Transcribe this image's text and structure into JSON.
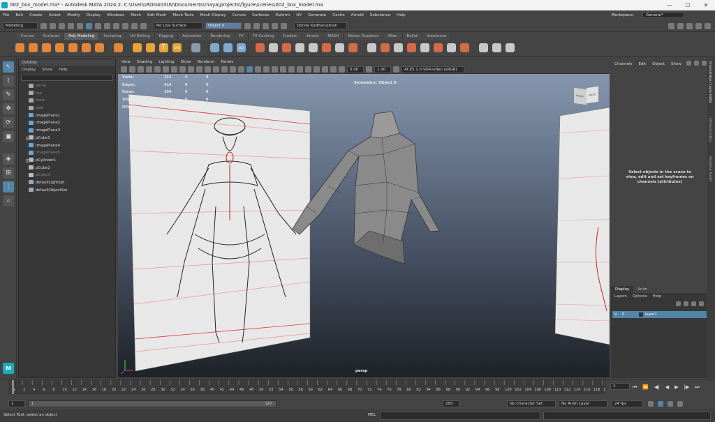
{
  "window": {
    "title": "002_box_model.ma* - Autodesk MAYA 2024.2: C:\\Users\\ROG403UV\\Documents\\maya\\projects\\figure\\scenes\\002_box_model.ma",
    "controls": [
      "—",
      "☐",
      "✕"
    ]
  },
  "menubar": {
    "items": [
      "File",
      "Edit",
      "Create",
      "Select",
      "Modify",
      "Display",
      "Windows",
      "Mesh",
      "Edit Mesh",
      "Mesh Tools",
      "Mesh Display",
      "Curves",
      "Surfaces",
      "Deform",
      "UV",
      "Generate",
      "Cache",
      "Arnold",
      "Substance",
      "Help"
    ],
    "workspace_label": "Workspace:",
    "workspace_value": "General*"
  },
  "statusline": {
    "mode": "Modeling",
    "live_surface": "No Live Surface",
    "symmetry": "Object X",
    "user": "Donita Kadharusman"
  },
  "shelf": {
    "tabs": [
      "Curves",
      "Surfaces",
      "Poly Modeling",
      "Sculpting",
      "UV Editing",
      "Rigging",
      "Animation",
      "Rendering",
      "FX",
      "FX Caching",
      "Custom",
      "Arnold",
      "MASH",
      "Motion Graphics",
      "XGen",
      "Bullet",
      "Substance"
    ],
    "active_tab": "Poly Modeling",
    "texts": {
      "svg": "SVG",
      "grid": "0.0"
    }
  },
  "outliner": {
    "title": "Outliner",
    "menu": [
      "Display",
      "Show",
      "Help"
    ],
    "items": [
      {
        "name": "persp",
        "dim": true
      },
      {
        "name": "top",
        "dim": true
      },
      {
        "name": "front",
        "dim": true
      },
      {
        "name": "side",
        "dim": true
      },
      {
        "name": "imagePlane1",
        "dim": false
      },
      {
        "name": "imagePlane2",
        "dim": false
      },
      {
        "name": "imagePlane3",
        "dim": false
      },
      {
        "name": "pCube1",
        "dim": false,
        "expand": true
      },
      {
        "name": "imagePlane4",
        "dim": false
      },
      {
        "name": "imagePlane5",
        "dim": true
      },
      {
        "name": "pCylinder1",
        "dim": false,
        "expand": true
      },
      {
        "name": "pCube2",
        "dim": false
      },
      {
        "name": "pCube3",
        "dim": true
      },
      {
        "name": "defaultLightSet",
        "dim": false
      },
      {
        "name": "defaultObjectSet",
        "dim": false
      }
    ]
  },
  "viewport": {
    "menu": [
      "View",
      "Shading",
      "Lighting",
      "Show",
      "Renderer",
      "Panels"
    ],
    "exposure": "0.00",
    "gamma": "1.00",
    "colorspace": "ACES 1.0 SDR-video (sRGB)",
    "hud": [
      [
        "Verts:",
        "212",
        "0",
        "0"
      ],
      [
        "Edges:",
        "416",
        "0",
        "0"
      ],
      [
        "Faces:",
        "204",
        "0",
        "0"
      ],
      [
        "Tris:",
        "408",
        "0",
        "0"
      ],
      [
        "UVs:",
        "264",
        "0",
        "0"
      ]
    ],
    "symmetry": "Symmetry: Object X",
    "camera": "persp",
    "cube_front": "FRONT",
    "cube_back": "BACK"
  },
  "channelbox": {
    "menu": [
      "Channels",
      "Edit",
      "Object",
      "Show"
    ],
    "message": "Select objects in the scene to view, edit and set keyframes on channels (attributes)"
  },
  "sidetabs": [
    "Channel Box / Layer Editor",
    "Attribute Editor",
    "Modeling Toolkit"
  ],
  "layers": {
    "tabs": [
      "Display",
      "Anim"
    ],
    "active_tab": "Display",
    "menu": [
      "Layers",
      "Options",
      "Help"
    ],
    "row": {
      "v": "V",
      "p": "P",
      "name": "layer1"
    }
  },
  "timeline": {
    "ticks": [
      "1",
      "2",
      "4",
      "6",
      "8",
      "10",
      "12",
      "14",
      "16",
      "18",
      "20",
      "22",
      "24",
      "26",
      "28",
      "30",
      "32",
      "34",
      "36",
      "38",
      "40",
      "42",
      "44",
      "46",
      "48",
      "50",
      "52",
      "54",
      "56",
      "58",
      "60",
      "62",
      "64",
      "66",
      "68",
      "70",
      "72",
      "74",
      "76",
      "78",
      "80",
      "82",
      "84",
      "86",
      "88",
      "90",
      "92",
      "94",
      "96",
      "98",
      "100",
      "102",
      "104",
      "106",
      "108",
      "110",
      "112",
      "114",
      "116",
      "118",
      "120"
    ],
    "current": "1"
  },
  "range": {
    "start": "1",
    "inner_start": "1",
    "inner_end": "120",
    "end": "200",
    "character_set": "No Character Set",
    "anim_layer": "No Anim Layer",
    "fps": "24 fps"
  },
  "command": {
    "help": "Select Tool: select an object",
    "lang": "MEL"
  }
}
